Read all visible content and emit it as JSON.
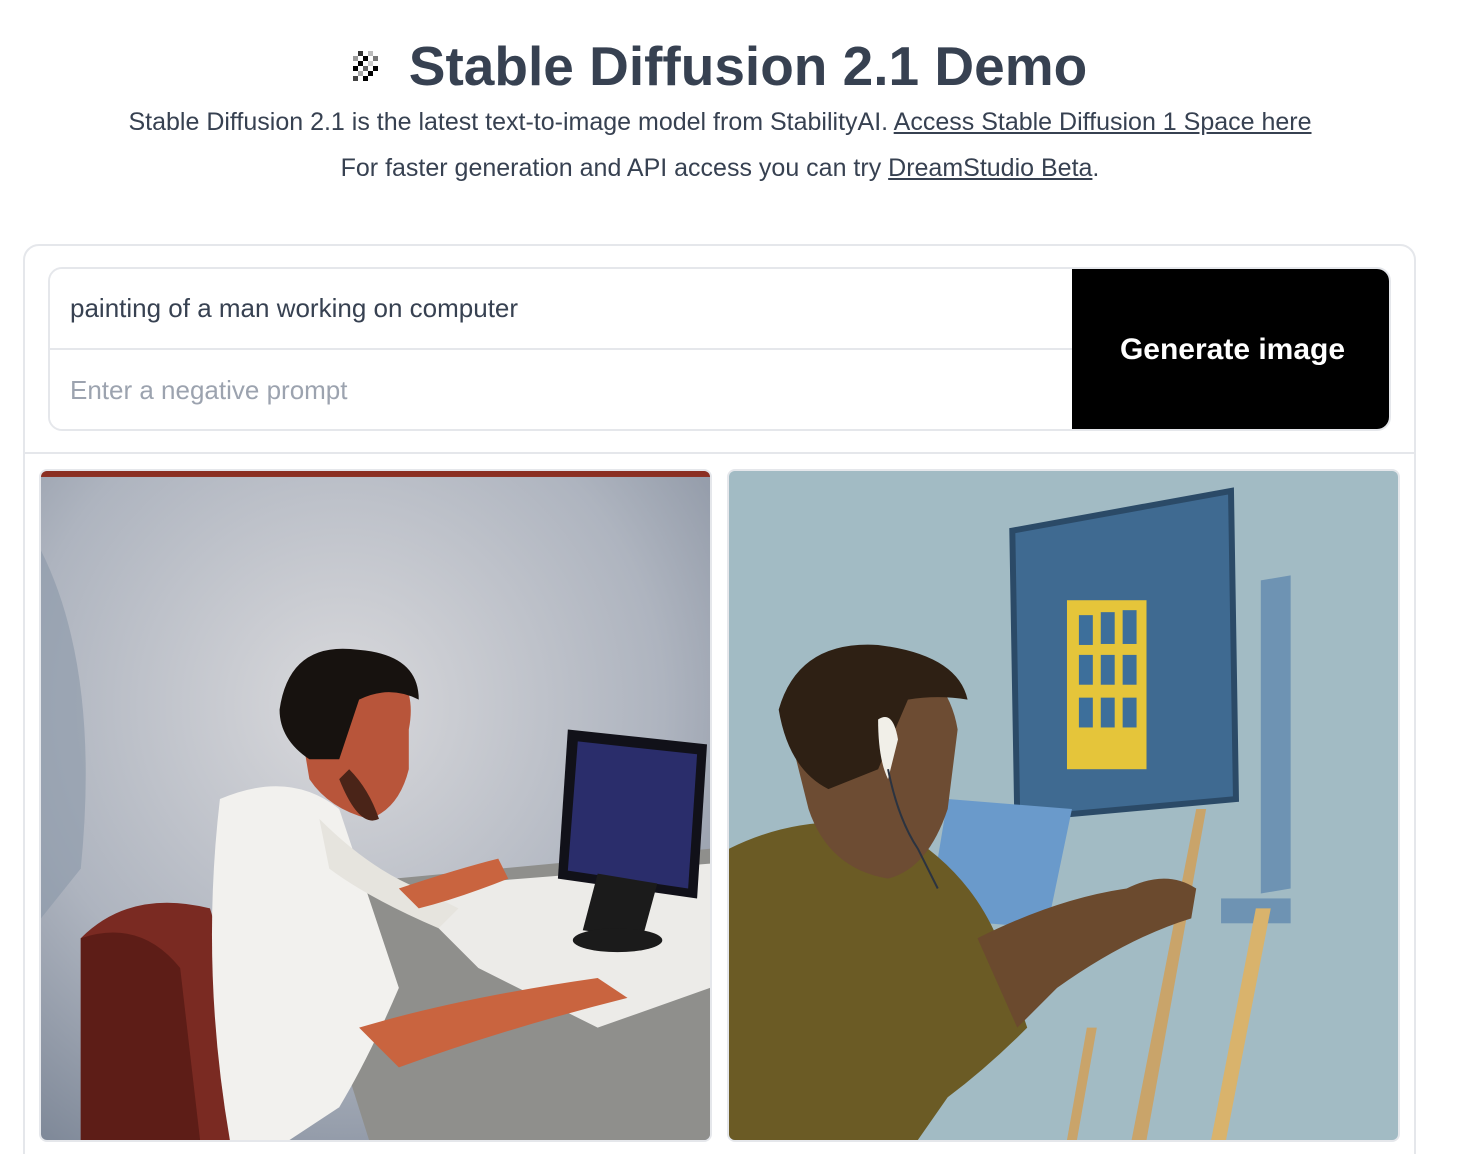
{
  "header": {
    "logo_icon": "pixel-logo-icon",
    "title": "Stable Diffusion 2.1 Demo",
    "line1_text": "Stable Diffusion 2.1 is the latest text-to-image model from StabilityAI. ",
    "line1_link": "Access Stable Diffusion 1 Space here",
    "line2_text_before": "For faster generation and API access you can try ",
    "line2_link": "DreamStudio Beta",
    "line2_text_after": "."
  },
  "form": {
    "prompt_value": "painting of a man working on computer",
    "negative_placeholder": "Enter a negative prompt",
    "negative_value": "",
    "generate_label": "Generate image"
  },
  "gallery": {
    "images": [
      {
        "subject": "man-at-laptop-painting"
      },
      {
        "subject": "man-with-earbuds-at-easel-painting"
      }
    ]
  },
  "colors": {
    "text": "#374151",
    "border": "#e5e7eb",
    "button_bg": "#000000",
    "button_text": "#ffffff",
    "placeholder": "#9ca3af"
  }
}
